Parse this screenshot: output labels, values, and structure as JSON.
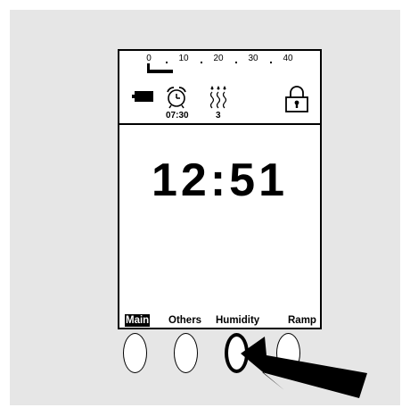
{
  "scale": {
    "ticks": [
      "0",
      "10",
      "20",
      "30",
      "40"
    ]
  },
  "status": {
    "battery_icon": "battery-icon",
    "alarm_icon": "alarm-clock-icon",
    "alarm_time": "07:30",
    "humidity_icon": "humidity-icon",
    "humidity_level": "3",
    "lock_icon": "padlock-icon"
  },
  "clock": {
    "time": "12:51"
  },
  "tabs": [
    {
      "label": "Main",
      "active": true
    },
    {
      "label": "Others",
      "active": false
    },
    {
      "label": "Humidity",
      "active": false
    },
    {
      "label": "Ramp",
      "active": false
    }
  ],
  "buttons": {
    "count": 4,
    "pressed_index": 2
  },
  "colors": {
    "background": "#e6e6e6",
    "screen": "#ffffff",
    "ink": "#000000"
  }
}
